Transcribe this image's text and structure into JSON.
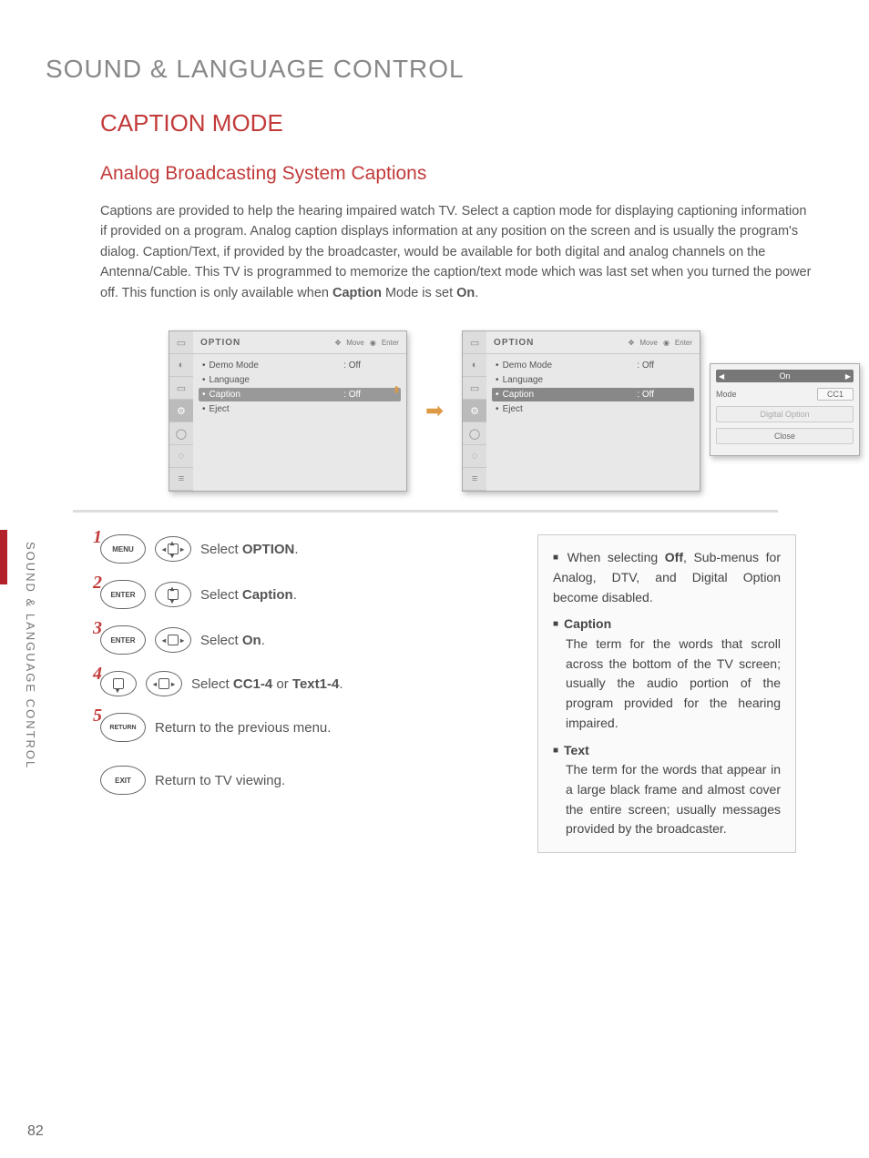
{
  "page": {
    "number": "82",
    "section_title": "SOUND & LANGUAGE CONTROL",
    "subtitle": "CAPTION MODE",
    "subheading": "Analog Broadcasting System Captions",
    "side_label": "SOUND & LANGUAGE CONTROL"
  },
  "intro": {
    "p1a": "Captions are provided to help the hearing impaired watch TV. Select a caption mode for displaying captioning information if provided on a program. Analog caption displays information at any position on the screen and is usually the program's dialog. Caption/Text, if provided by the broadcaster, would be available for both digital and analog channels on the Antenna/Cable. This TV is programmed to memorize the caption/text mode which was last set when you turned the power off. This function is only available when ",
    "p1b": "Caption",
    "p1c": " Mode is set ",
    "p1d": "On",
    "p1e": "."
  },
  "osd": {
    "title": "OPTION",
    "move": "Move",
    "enter": "Enter",
    "items": {
      "demo": "Demo Mode",
      "demo_val": ": Off",
      "lang": "Language",
      "caption": "Caption",
      "caption_val": ": Off",
      "eject": "Eject"
    },
    "popup": {
      "on": "On",
      "mode": "Mode",
      "cc1": "CC1",
      "digital": "Digital Option",
      "close": "Close"
    }
  },
  "steps": {
    "s1": {
      "btn": "MENU",
      "text_a": "Select ",
      "text_b": "OPTION",
      "text_c": "."
    },
    "s2": {
      "btn": "ENTER",
      "text_a": "Select ",
      "text_b": "Caption",
      "text_c": "."
    },
    "s3": {
      "btn": "ENTER",
      "text_a": "Select ",
      "text_b": "On",
      "text_c": "."
    },
    "s4": {
      "text_a": "Select ",
      "text_b": "CC1-4",
      "text_c": " or ",
      "text_d": "Text1-4",
      "text_e": "."
    },
    "s5": {
      "btn": "RETURN",
      "text": "Return to the previous menu."
    },
    "s6": {
      "btn": "EXIT",
      "text": "Return to TV viewing."
    }
  },
  "right": {
    "r1a": "When selecting ",
    "r1b": "Off",
    "r1c": ", Sub-menus for Analog, DTV, and Digital Option become disabled.",
    "r2t": "Caption",
    "r2": "The term for the words that scroll across the bottom of the TV screen; usually the audio portion of the program provided for the hearing impaired.",
    "r3t": "Text",
    "r3": "The term for the words that appear in a large black frame and almost cover the entire screen; usually messages provided by the broadcaster."
  }
}
